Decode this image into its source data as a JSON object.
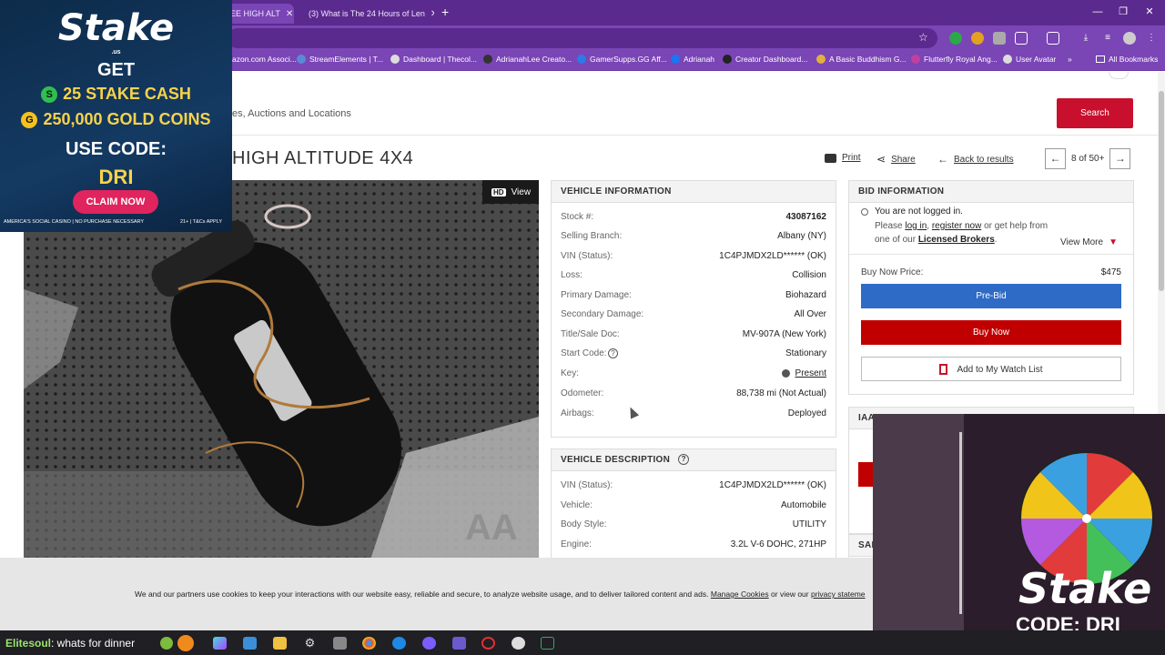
{
  "browser": {
    "tabs": [
      {
        "title": "EE HIGH ALT",
        "active": true
      },
      {
        "title": "(3) What is The 24 Hours of Len",
        "active": false
      }
    ],
    "new_tab": "+",
    "window": {
      "minimize": "—",
      "restore": "❐",
      "close": "✕"
    },
    "address": "",
    "bookmarks": [
      "azon.com Associ...",
      "StreamElements | T...",
      "Dashboard | Thecol...",
      "AdrianahLee Creato...",
      "GamerSupps.GG Aff...",
      "Adrianah",
      "Creator Dashboard...",
      "A Basic Buddhism G...",
      "Flutterfly Royal Ang...",
      "User Avatar"
    ],
    "bookmarks_more": "»",
    "all_bookmarks": "All Bookmarks"
  },
  "page": {
    "search_placeholder": "es, Auctions and Locations",
    "search_button": "Search",
    "vehicle_title": "HIGH ALTITUDE 4X4",
    "actions": {
      "print": "Print",
      "share": "Share",
      "back": "Back to results"
    },
    "pager": {
      "text": "8 of 50+",
      "prev": "←",
      "next": "→"
    },
    "photo": {
      "hd_badge": "HD",
      "view_label": "View"
    },
    "vehicle_info": {
      "heading": "VEHICLE INFORMATION",
      "rows": [
        {
          "label": "Stock #:",
          "value": "43087162"
        },
        {
          "label": "Selling Branch:",
          "value": "Albany (NY)"
        },
        {
          "label": "VIN (Status):",
          "value": "1C4PJMDX2LD****** (OK)"
        },
        {
          "label": "Loss:",
          "value": "Collision"
        },
        {
          "label": "Primary Damage:",
          "value": "Biohazard"
        },
        {
          "label": "Secondary Damage:",
          "value": "All Over"
        },
        {
          "label": "Title/Sale Doc:",
          "value": "MV-907A (New York)"
        },
        {
          "label": "Start Code:",
          "value": "Stationary"
        },
        {
          "label": "Key:",
          "value": "Present"
        },
        {
          "label": "Odometer:",
          "value": "88,738 mi (Not Actual)"
        },
        {
          "label": "Airbags:",
          "value": "Deployed"
        }
      ]
    },
    "vehicle_desc": {
      "heading": "VEHICLE DESCRIPTION",
      "rows": [
        {
          "label": "VIN (Status):",
          "value": "1C4PJMDX2LD****** (OK)"
        },
        {
          "label": "Vehicle:",
          "value": "Automobile"
        },
        {
          "label": "Body Style:",
          "value": "UTILITY"
        },
        {
          "label": "Engine:",
          "value": "3.2L V-6 DOHC, 271HP"
        }
      ]
    },
    "bid_info": {
      "heading": "BID INFORMATION",
      "not_logged_in": "You are not logged in.",
      "please": "Please",
      "log_in": "log in",
      "comma": ",",
      "register_now": "register now",
      "or_help": "or get help from",
      "one_of_our": "one of our",
      "licensed_brokers": "Licensed Brokers",
      "period": ".",
      "view_more": "View More",
      "buy_now_label": "Buy Now Price:",
      "buy_now_price": "$475",
      "prebid": "Pre-Bid",
      "buy_now": "Buy Now",
      "watch_list": "Add to My Watch List"
    },
    "iaa_heading": "IAA",
    "sal_heading": "SAL"
  },
  "cookie": {
    "text": "We and our partners use cookies to keep your interactions with our website easy, reliable and secure, to analyze website usage, and to deliver tailored content and ads.",
    "manage": "Manage Cookies",
    "or_view": "or view our",
    "privacy": "privacy stateme"
  },
  "stake_ad": {
    "logo": "Stake",
    "logo_sub": ".us",
    "get": "GET",
    "line1_coin": "S",
    "line1": "25 STAKE CASH",
    "line2_coin": "G",
    "line2": "250,000 GOLD COINS",
    "use_code": "USE CODE:",
    "code": "DRI",
    "claim": "CLAIM NOW",
    "footer_left": "AMERICA'S SOCIAL CASINO | NO PURCHASE NECESSARY",
    "footer_right": "21+ | T&Cs APPLY"
  },
  "webcam": {
    "logo": "Stake",
    "code": "CODE: DRI"
  },
  "taskbar": {
    "chat_user": "Elitesoul",
    "chat_text": ": whats for dinner"
  },
  "colors": {
    "brand_red": "#c8102e",
    "prebid_blue": "#2e6bc6",
    "buynow_red": "#c00000",
    "browser_purple": "#5b2a8e"
  }
}
